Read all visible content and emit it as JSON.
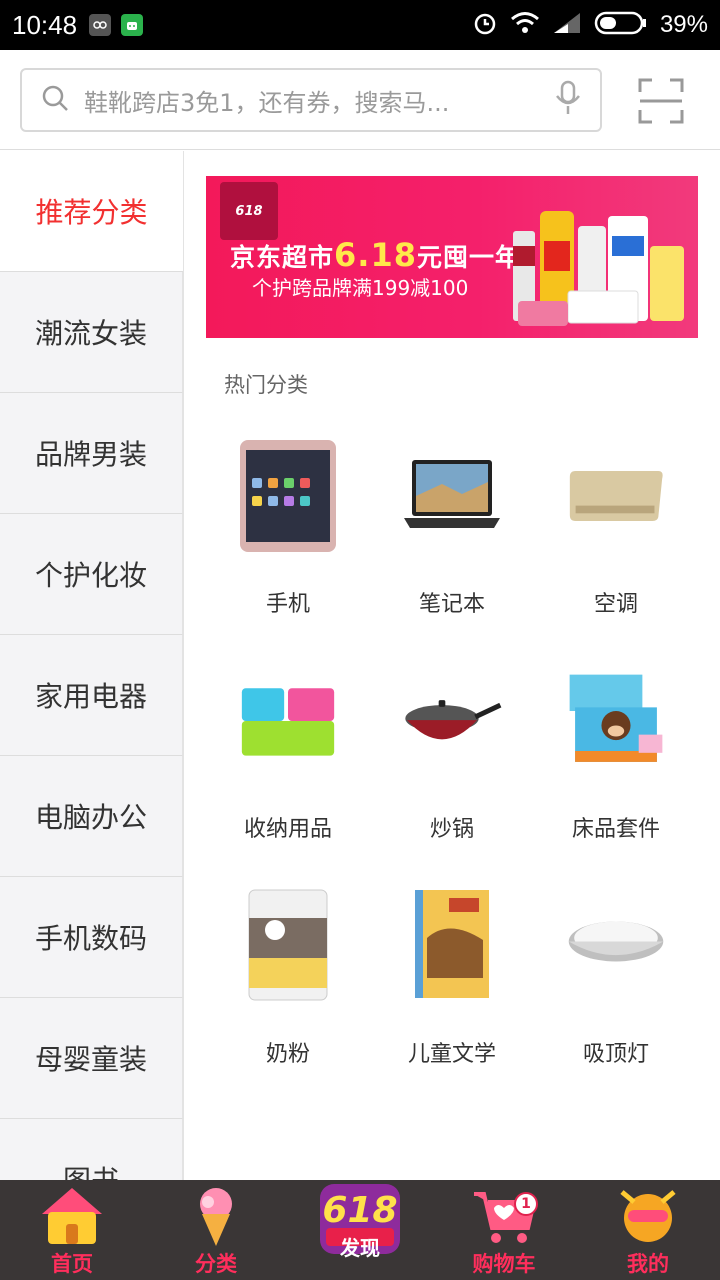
{
  "status_bar": {
    "time": "10:48",
    "battery": "39%"
  },
  "search": {
    "placeholder": "鞋靴跨店3免1，还有券，搜索马..."
  },
  "sidebar": {
    "items": [
      {
        "label": "推荐分类",
        "active": true
      },
      {
        "label": "潮流女装"
      },
      {
        "label": "品牌男装"
      },
      {
        "label": "个护化妆"
      },
      {
        "label": "家用电器"
      },
      {
        "label": "电脑办公"
      },
      {
        "label": "手机数码"
      },
      {
        "label": "母婴童装"
      },
      {
        "label": "图书"
      }
    ]
  },
  "banner": {
    "logo_text": "618",
    "line1_prefix": "京东超市",
    "line1_highlight": "6.18",
    "line1_suffix": "元囤一年",
    "line2": "个护跨品牌满199减100"
  },
  "section": {
    "title": "热门分类"
  },
  "categories": [
    {
      "label": "手机",
      "icon": "phone-icon"
    },
    {
      "label": "笔记本",
      "icon": "laptop-icon"
    },
    {
      "label": "空调",
      "icon": "air-conditioner-icon"
    },
    {
      "label": "收纳用品",
      "icon": "storage-box-icon"
    },
    {
      "label": "炒锅",
      "icon": "wok-icon"
    },
    {
      "label": "床品套件",
      "icon": "bedding-icon"
    },
    {
      "label": "奶粉",
      "icon": "milk-powder-icon"
    },
    {
      "label": "儿童文学",
      "icon": "book-icon"
    },
    {
      "label": "吸顶灯",
      "icon": "ceiling-lamp-icon"
    }
  ],
  "tabbar": {
    "items": [
      {
        "label": "首页",
        "icon": "home-icon"
      },
      {
        "label": "分类",
        "icon": "category-icon"
      },
      {
        "label": "发现",
        "icon": "discover-icon",
        "badge_text": "618"
      },
      {
        "label": "购物车",
        "icon": "cart-icon",
        "count": "1"
      },
      {
        "label": "我的",
        "icon": "profile-icon"
      }
    ]
  },
  "colors": {
    "accent": "#f23030",
    "tab_label": "#ff2e5c",
    "tabbar_bg": "#3a3636"
  }
}
